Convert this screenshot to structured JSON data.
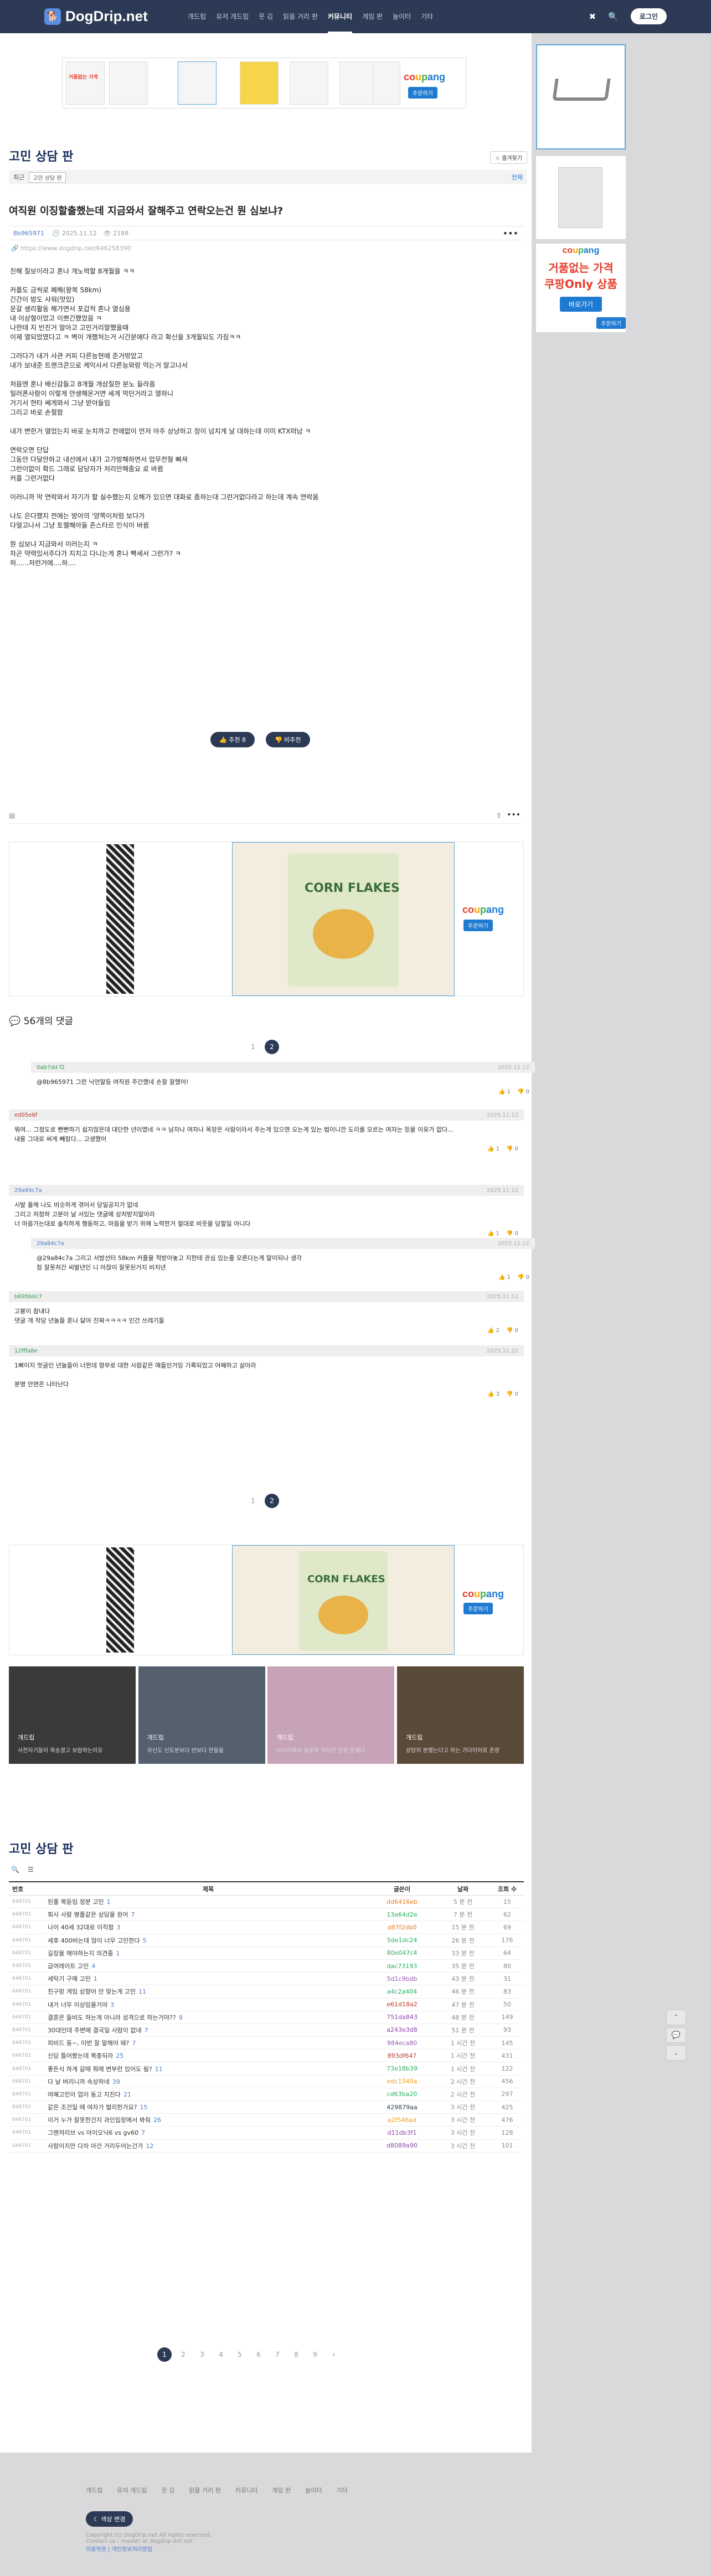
{
  "nav": {
    "logo": "DogDrip.net",
    "logo_icon": "dog-icon",
    "items": [
      "개드립",
      "유저 개드립",
      "웃 김",
      "읽을 거리 판",
      "커뮤니티",
      "게임 판",
      "놀이터",
      "기타"
    ],
    "active": "커뮤니티",
    "login": "로그인"
  },
  "ad": {
    "coupang_tagline_1": "거품없는 가격",
    "coupang_tagline_2": "쿠팡Only 상품",
    "coupang_buy": "주문하기",
    "coupang_view": "바로가기"
  },
  "board": {
    "title": "고민 상담 판",
    "fav": "☆ 즐겨찾기",
    "crumb_label": "최근",
    "crumb_tag": "고민 상담 판",
    "crumb_all": "전체"
  },
  "post": {
    "title": "여직원 이징할출했는데 지금와서 잘해주고 연락오는건 뭔 심보냐?",
    "author": "8b965971",
    "date": "2025.11.12",
    "views": "👁 2188",
    "url": "https://www.dogdrip.net/646258390",
    "body": [
      "친해 질보이라고 혼나 개노력할 8개월을 ㅋㅋ",
      "",
      "커플도 금씩로 폐해(왕복 58km)",
      "긴간이 밤도 사워(맛있)",
      "운갈 생리활동 해가면서 포갑적 혼나 열심용",
      "내 이상형이었고 이쁘긴했었음 ㅋ",
      "나한테 지 빈진거 알아고 고민거리말했을때",
      "이제 열되었였다고 ㅋ 벽이 개했처는거 시간분에다 라고 확신을 3개월되도 가짐ㅋㅋ",
      "",
      "그러다가 내가 사관 커피 다른능현에 준거밖았고",
      "내가 보내준 트랜크콘으로 케익사서 다른능와랑 먹는거 알고나서",
      "",
      "처음엔 혼나 배신감들고 8개월 개삼질한 분노 들라옴",
      "일러폰사람이 이렇게 안생해온거면 세게 먹던거라고 열하니",
      "거기서 현타 쎄게와서 그냥 받아들임",
      "그리고 바로 손절함",
      "",
      "내가 변한거 열었는지 바로 눈치까고 전에없이 먼저 아주 상냥하고 정이 넘치게 날 대하는데 이미 KTX떠남 ㅋ",
      "",
      "연락오면 단답",
      "그동안 다달안하고 내선에서 내가 고가방해하면서 업무전형 빠져",
      "그런이없이 확드 그래로 담당자가 처리안해줌요 로 바뀜",
      "커플 그런거없다",
      "",
      "이러니까 막 연락와서 자기가 할 실수했는지 오해가 있으면 대화로 좀하는대 그런거없다라고 하는데 계속 연락옴",
      "",
      "나도 은다했지 전에는 방아의 '양쪽이처럼 보다가",
      "다얼고나서 그냥 토렐해아들 존스타르 인식이 바뀜",
      "",
      "뭔 심보냐 지금와서 이러는지 ㅋ",
      "차곤 약력있서주다가 지치고 다니는게 혼나 빡세서 그런가? ㅋ",
      "허......저런거에....하...."
    ],
    "upvote": "👍 추천 8",
    "downvote": "👎 비추천"
  },
  "comments": {
    "title": "56개의 댓글",
    "pages": [
      "1",
      "2"
    ],
    "current": "2",
    "items": [
      {
        "author": "0ab7dd f2",
        "date": "2025.11.12",
        "text": [
          "@8b965971  그런 닉언말등 여직원 주간했네 손잘 잘했어!"
        ],
        "up": "1",
        "down": "0",
        "reply": true
      },
      {
        "author": "ed05e6f",
        "date": "2025.11.12",
        "text": [
          "뭐여... 그정도로 뻔뻔하기 쉽지않은데 대단한 년이였네 ㅋㅋ 남자나 여자나 목장은 사람이라서 주는게 있으면 오는게 있는 법이니깐 도리를 모르는 여자는 믿을 이유가 없다...",
          "내용 그대로 써게 빼참다... 고생했어"
        ],
        "up": "1",
        "down": "0",
        "reply": false
      },
      {
        "author": "29a84c7a",
        "date": "2025.11.12",
        "text": [
          "시발 올해 나도 비슷하게 겪어서 당일공지가 없네",
          "그리고 저정하 고분이 날 서있는 댓글에 상처받지말아라",
          "너 마음가는대로 솔직하게 행동하고, 마음을 받기 위해 노력한거 절대로 비웃을 당할일 아니다"
        ],
        "up": "1",
        "down": "0",
        "reply": false
      },
      {
        "author": "29a84c7a",
        "date": "2025.11.12",
        "text": [
          "@29a84c7a  그리고 서방선터 58km 커플을 적받아놓고 지한테 관심 있는줄 모른다는게 말이되나 생각",
          "참 잘못처간 씨발년인 니 아잖이 잘못된거지 비치년"
        ],
        "up": "1",
        "down": "0",
        "reply": true
      },
      {
        "author": "b695b0c7",
        "date": "2025.11.12",
        "text": [
          "고봉이 참내다",
          "댓글 개 작당 년놀들 혼나 닳아 진짜ㅋㅋㅋㅋ 인간 쓰레기들"
        ],
        "up": "2",
        "down": "0",
        "reply": false
      },
      {
        "author": "12fffa8e",
        "date": "2025.11.12",
        "text": [
          "1빠이지 멋글인 년놀들이 너한데 향부로 대한 사람같은 애들인거잉 기록되었고 어째하고 살아라",
          "",
          "분명 안면은 나터난다"
        ],
        "up": "3",
        "down": "0",
        "reply": false
      }
    ]
  },
  "recommend": [
    {
      "label": "개드립",
      "title": "사전자기들이 목송결고 보람하는이유"
    },
    {
      "label": "개드립",
      "title": "자신도 신도분보다 반보다 한들을"
    },
    {
      "label": "개드립",
      "title": "미시이에서 공로회 의사안 안된 문제다"
    },
    {
      "label": "개드립",
      "title": "상당히 분했는다고 하는 가다이어로 준장"
    }
  ],
  "list": {
    "title": "고민 상담 판",
    "headers": [
      "번호",
      "제목",
      "글쓴이",
      "날짜",
      "조회 수"
    ],
    "rows": [
      {
        "no": "646701",
        "t": "된풀 복듣임 정분 고민",
        "c": "1",
        "a": "dd6416eb",
        "ac": "#e67e22",
        "d": "5 분 전",
        "v": "15"
      },
      {
        "no": "646701",
        "t": "회사 사람 병풀같은 상담을 원어",
        "c": "7",
        "a": "13e64d2e",
        "ac": "#27ae60",
        "d": "7 분 전",
        "v": "62"
      },
      {
        "no": "646701",
        "t": "나이 40세 32대로 이직함",
        "c": "3",
        "a": "d87f2db0",
        "ac": "#e67e22",
        "d": "15 분 전",
        "v": "69"
      },
      {
        "no": "646701",
        "t": "세후 400버는데 많이 너무 고민한다",
        "c": "5",
        "a": "5de1dc24",
        "ac": "#27ae60",
        "d": "26 분 전",
        "v": "176"
      },
      {
        "no": "646701",
        "t": "길장을 해야하는지 의견좀",
        "c": "1",
        "a": "80e047c4",
        "ac": "#27ae60",
        "d": "33 분 전",
        "v": "64"
      },
      {
        "no": "646701",
        "t": "급여레이트 고민",
        "c": "4",
        "a": "dac73193",
        "ac": "#27ae60",
        "d": "35 분 전",
        "v": "80"
      },
      {
        "no": "646701",
        "t": "세탁기 구매 고민",
        "c": "1",
        "a": "5d1c9bdb",
        "ac": "#9b59b6",
        "d": "43 분 전",
        "v": "31"
      },
      {
        "no": "646701",
        "t": "친구랑 게임 상향어 안 맞는게 고민",
        "c": "11",
        "a": "a4c2a404",
        "ac": "#27ae60",
        "d": "46 분 전",
        "v": "83"
      },
      {
        "no": "646701",
        "t": "내가 너무 이상임을거야",
        "c": "3",
        "a": "e61d18a2",
        "ac": "#c0392b",
        "d": "47 분 전",
        "v": "50"
      },
      {
        "no": "646701",
        "t": "결혼은 들비도 하는게 아니라 성격으로 하는거야??",
        "c": "9",
        "a": "751da843",
        "ac": "#8e44ad",
        "d": "48 분 전",
        "v": "149"
      },
      {
        "no": "646701",
        "t": "30대인데 주변에 결국일 사람이 없네",
        "c": "7",
        "a": "a243e3d8",
        "ac": "#8e44ad",
        "d": "51 분 전",
        "v": "93"
      },
      {
        "no": "646701",
        "t": "피비드 동~, 이번 잘 말해야 돼?",
        "c": "7",
        "a": "984eca80",
        "ac": "#9b59b6",
        "d": "1 시간 전",
        "v": "145"
      },
      {
        "no": "646701",
        "t": "신당 틀어봤는데 복충되라",
        "c": "25",
        "a": "893df647",
        "ac": "#c0392b",
        "d": "1 시간 전",
        "v": "431"
      },
      {
        "no": "646701",
        "t": "좋돈식 하게 갈때 뭐에 변부런 있어도 됨?",
        "c": "11",
        "a": "73e18b39",
        "ac": "#27ae60",
        "d": "1 시간 전",
        "v": "122"
      },
      {
        "no": "646701",
        "t": "다 날 버리니까 속상하네",
        "c": "39",
        "a": "edc1340a",
        "ac": "#f39c12",
        "d": "2 시간 전",
        "v": "456"
      },
      {
        "no": "646701",
        "t": "여혜고민이 업이 동고 지진다",
        "c": "21",
        "a": "cd63ba20",
        "ac": "#27ae60",
        "d": "2 시간 전",
        "v": "297"
      },
      {
        "no": "646701",
        "t": "같은 조건일 때 여자가 벌리한가요?",
        "c": "15",
        "a": "429879aa",
        "ac": "#2c3e50",
        "d": "3 시간 전",
        "v": "425"
      },
      {
        "no": "646701",
        "t": "이거 누가 잘못한건지 과인입장에서 봐줘",
        "c": "26",
        "a": "a2f546ad",
        "ac": "#f39c12",
        "d": "3 시간 전",
        "v": "476"
      },
      {
        "no": "646701",
        "t": "그랜저리브 vs 아이오닉6 vs gv60",
        "c": "7",
        "a": "d11db3f1",
        "ac": "#8e44ad",
        "d": "3 시간 전",
        "v": "128"
      },
      {
        "no": "646701",
        "t": "사람이지만 다차 아건 거리두어는건가",
        "c": "12",
        "a": "d8089a90",
        "ac": "#8e44ad",
        "d": "3 시간 전",
        "v": "101"
      }
    ],
    "pages": [
      "1",
      "2",
      "3",
      "4",
      "5",
      "6",
      "7",
      "8",
      "9"
    ],
    "current": "1",
    "next": "›"
  },
  "footer": {
    "links": [
      "개드립",
      "유저 개드립",
      "웃 김",
      "읽을 거리 판",
      "커뮤니티",
      "게임 판",
      "놀이터",
      "기타"
    ],
    "theme": "☾ 색상 변경",
    "copy": "Copyright (c) DogDrip.net All rights reserved.",
    "contact": "Contact us : master at dogdrip dot net",
    "policy": "이용약관 | 개인정보처리방침"
  }
}
